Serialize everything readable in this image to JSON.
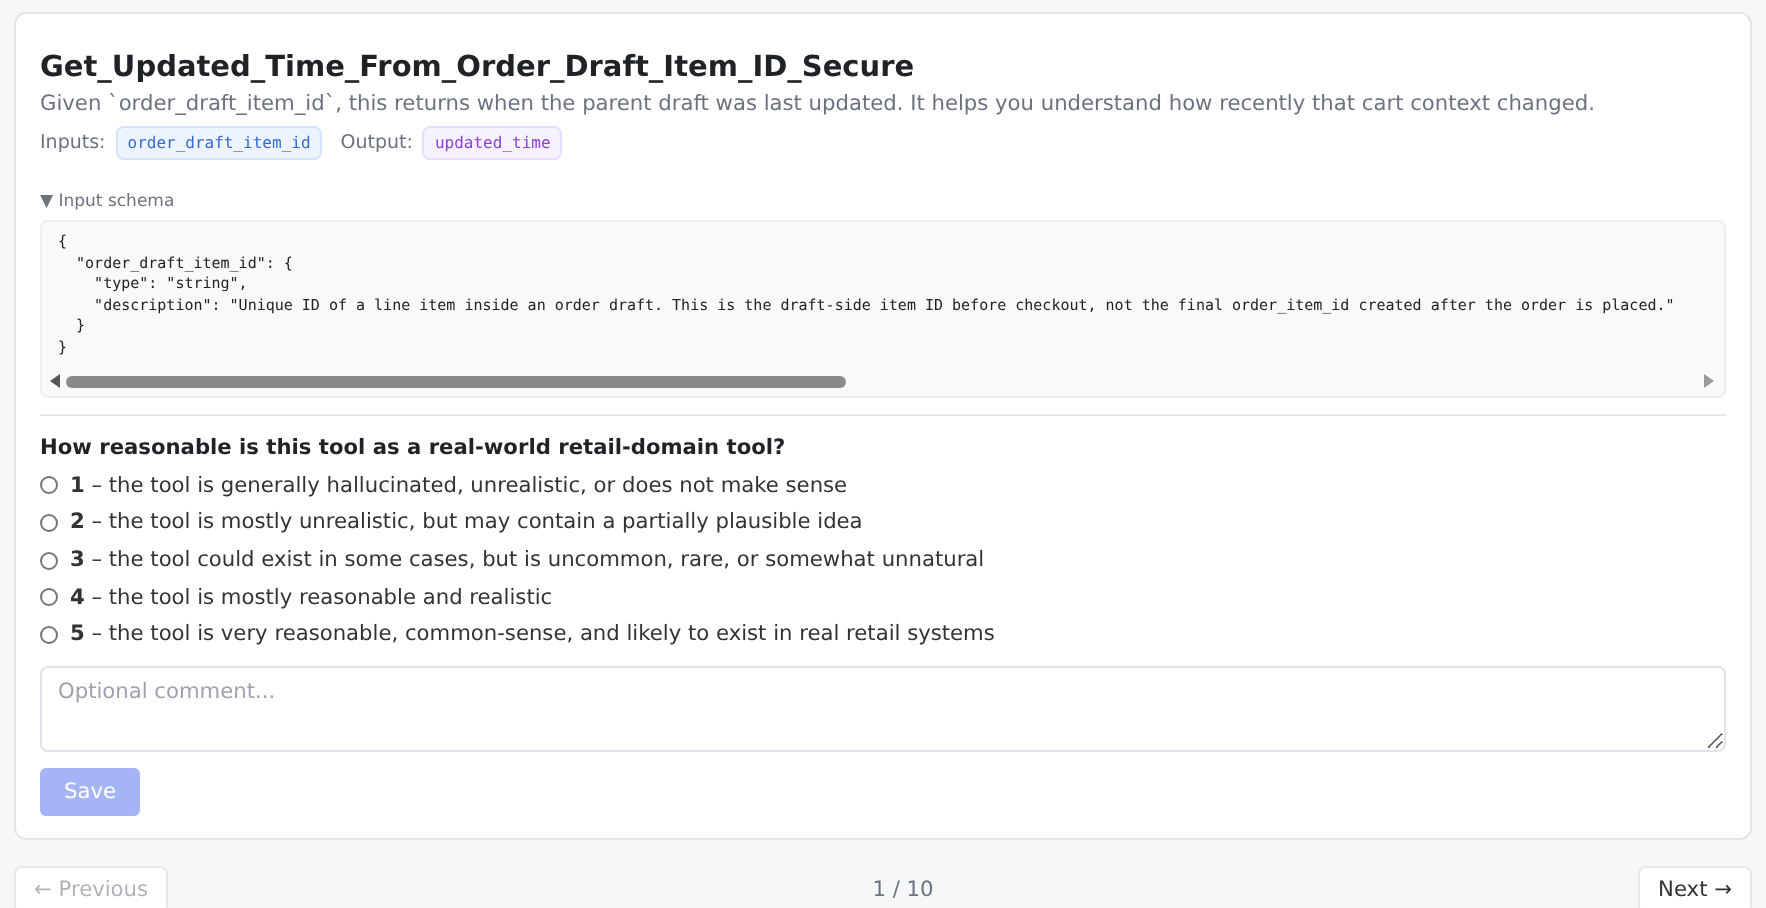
{
  "tool": {
    "title": "Get_Updated_Time_From_Order_Draft_Item_ID_Secure",
    "description": "Given `order_draft_item_id`, this returns when the parent draft was last updated. It helps you understand how recently that cart context changed.",
    "io": [
      {
        "label": "Inputs:",
        "value": "order_draft_item_id",
        "kind": "input"
      },
      {
        "label": "Output:",
        "value": "updated_time",
        "kind": "output"
      }
    ],
    "schema": {
      "toggle": "▼ Input schema",
      "lines": [
        "{",
        "  \"order_draft_item_id\": {",
        "    \"type\": \"string\",",
        "    \"description\": \"Unique ID of a line item inside an order draft. This is the draft-side item ID before checkout, not the final order_item_id created after the order is placed.\"",
        "  }",
        "}"
      ]
    }
  },
  "question": "How reasonable is this tool as a real-world retail-domain tool?",
  "options": [
    {
      "label": "**1** – the tool is generally hallucinated, unrealistic, or does not make sense",
      "selected": false
    },
    {
      "label": "**2** – the tool is mostly unrealistic, but may contain a partially plausible idea",
      "selected": false
    },
    {
      "label": "**3** – the tool could exist in some cases, but is uncommon, rare, or somewhat unnatural",
      "selected": false
    },
    {
      "label": "**4** – the tool is mostly reasonable and realistic",
      "selected": false
    },
    {
      "label": "**5** – the tool is very reasonable, common-sense, and likely to exist in real retail systems",
      "selected": false
    }
  ],
  "comment": {
    "placeholder": "Optional comment..."
  },
  "save": {
    "label": "Save",
    "disabled": true
  },
  "pager": {
    "previous": {
      "label": "← Previous",
      "disabled": true
    },
    "position": "1 / 10",
    "next": {
      "label": "Next →",
      "disabled": false
    }
  }
}
